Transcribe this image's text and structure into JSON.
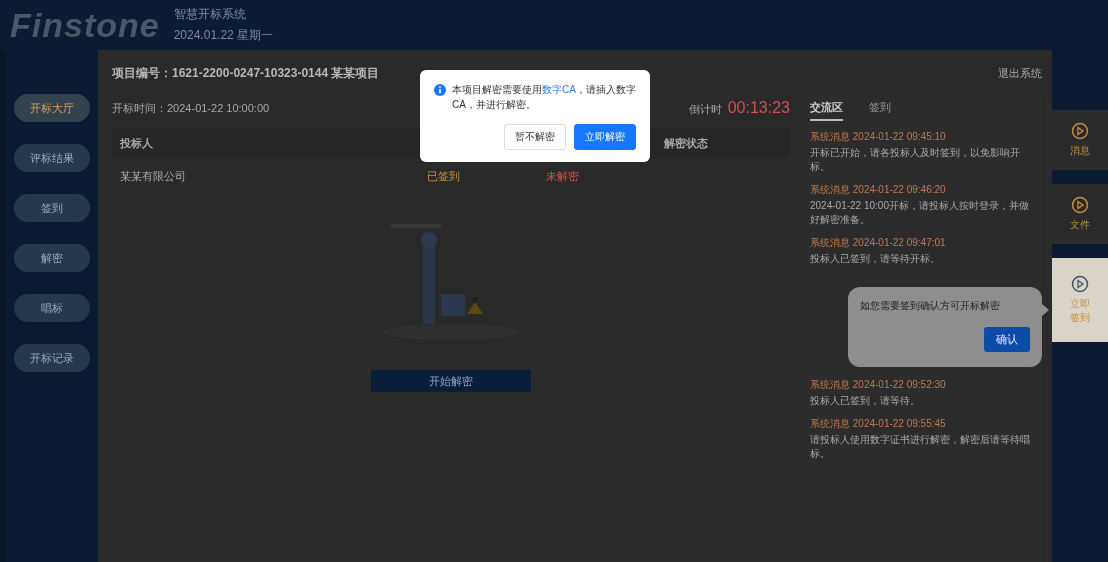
{
  "header": {
    "logo": "Finstone",
    "subtitle": "智慧开标系统",
    "date": "2024.01.22 星期一"
  },
  "sidebar": {
    "items": [
      {
        "label": "开标大厅",
        "selected": true
      },
      {
        "label": "评标结果",
        "selected": false
      },
      {
        "label": "签到",
        "selected": false
      },
      {
        "label": "解密",
        "selected": false
      },
      {
        "label": "唱标",
        "selected": false
      },
      {
        "label": "开标记录",
        "selected": false
      }
    ]
  },
  "project": {
    "title": "项目编号：1621-2200-0247-10323-0144 某某项目",
    "exit": "退出系统",
    "open_time": "开标时间：2024-01-22 10:00:00",
    "countdown_label": "倒计时",
    "countdown": "00:13:23"
  },
  "table": {
    "columns": [
      "投标人",
      "解密状态"
    ],
    "rows": [
      {
        "cells": [
          "某某有限公司",
          "已签到",
          "未解密",
          ""
        ]
      }
    ]
  },
  "start_button": "开始解密",
  "chat": {
    "tabs": [
      {
        "label": "交流区",
        "selected": true
      },
      {
        "label": "签到",
        "selected": false
      }
    ],
    "messages": [
      {
        "author": "系统消息",
        "time": "2024-01-22 09:45:10",
        "text": "开标已开始，请各投标人及时签到，以免影响开标。"
      },
      {
        "author": "系统消息",
        "time": "2024-01-22 09:46:20",
        "text": "2024-01-22 10:00开标，请投标人按时登录，并做好解密准备。"
      },
      {
        "author": "系统消息",
        "time": "2024-01-22 09:47:01",
        "text": "投标人已签到，请等待开标。"
      },
      {
        "author": "系统消息",
        "time": "2024-01-22 09:52:30",
        "text": "投标人已签到，请等待。"
      },
      {
        "author": "系统消息",
        "time": "2024-01-22 09:55:45",
        "text": "请投标人使用数字证书进行解密，解密后请等待唱标。"
      }
    ]
  },
  "side_tabs": [
    {
      "label": "消息",
      "selected": false
    },
    {
      "label": "文件",
      "selected": false
    },
    {
      "label": "立即签到",
      "selected": true
    }
  ],
  "dialog": {
    "text": "本项目解密需要使用**数字CA**，请插入数字CA，并进行解密。",
    "cancel": "暂不解密",
    "confirm": "立即解密"
  },
  "tooltip": {
    "text": "如您需要签到确认方可开标解密",
    "button": "确认"
  }
}
